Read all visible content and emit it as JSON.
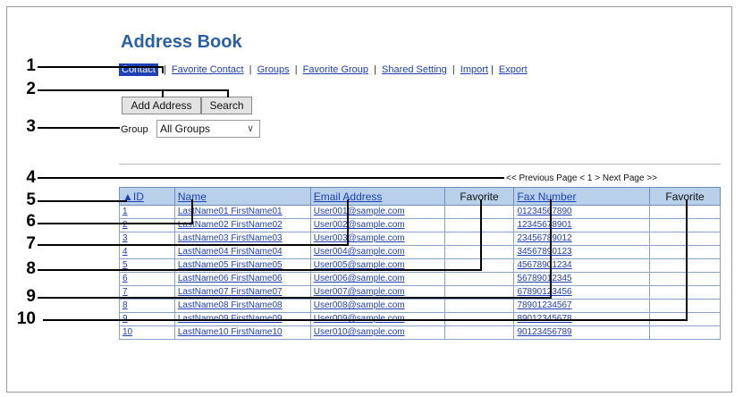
{
  "title": "Address Book",
  "nav": {
    "items": [
      {
        "label": "Contact",
        "active": true
      },
      {
        "label": "Favorite Contact"
      },
      {
        "label": "Groups"
      },
      {
        "label": "Favorite Group"
      },
      {
        "label": "Shared Setting"
      },
      {
        "label": "Import"
      },
      {
        "label": "Export"
      }
    ],
    "separator": "|"
  },
  "buttons": {
    "add_address": "Add Address",
    "search": "Search"
  },
  "group": {
    "label": "Group",
    "selected": "All Groups",
    "chevron": "∨"
  },
  "pager": "<< Previous Page < 1 > Next Page >>",
  "table": {
    "headers": {
      "id": "▲ID",
      "name": "Name",
      "email": "Email Address",
      "favorite1": "Favorite",
      "fax": "Fax Number",
      "favorite2": "Favorite"
    },
    "rows": [
      {
        "id": "1",
        "name": "LastName01 FirstName01",
        "email": "User001@sample.com",
        "fax": "01234567890"
      },
      {
        "id": "2",
        "name": "LastName02 FirstName02",
        "email": "User002@sample.com",
        "fax": "12345678901"
      },
      {
        "id": "3",
        "name": "LastName03 FirstName03",
        "email": "User003@sample.com",
        "fax": "23456789012"
      },
      {
        "id": "4",
        "name": "LastName04 FirstName04",
        "email": "User004@sample.com",
        "fax": "34567890123"
      },
      {
        "id": "5",
        "name": "LastName05 FirstName05",
        "email": "User005@sample.com",
        "fax": "45678901234"
      },
      {
        "id": "6",
        "name": "LastName06 FirstName06",
        "email": "User006@sample.com",
        "fax": "56789012345"
      },
      {
        "id": "7",
        "name": "LastName07 FirstName07",
        "email": "User007@sample.com",
        "fax": "67890123456"
      },
      {
        "id": "8",
        "name": "LastName08 FirstName08",
        "email": "User008@sample.com",
        "fax": "78901234567"
      },
      {
        "id": "9",
        "name": "LastName09 FirstName09",
        "email": "User009@sample.com",
        "fax": "89012345678"
      },
      {
        "id": "10",
        "name": "LastName10 FirstName10",
        "email": "User010@sample.com",
        "fax": "90123456789"
      }
    ]
  },
  "callouts": [
    "1",
    "2",
    "3",
    "4",
    "5",
    "6",
    "7",
    "8",
    "9",
    "10"
  ]
}
